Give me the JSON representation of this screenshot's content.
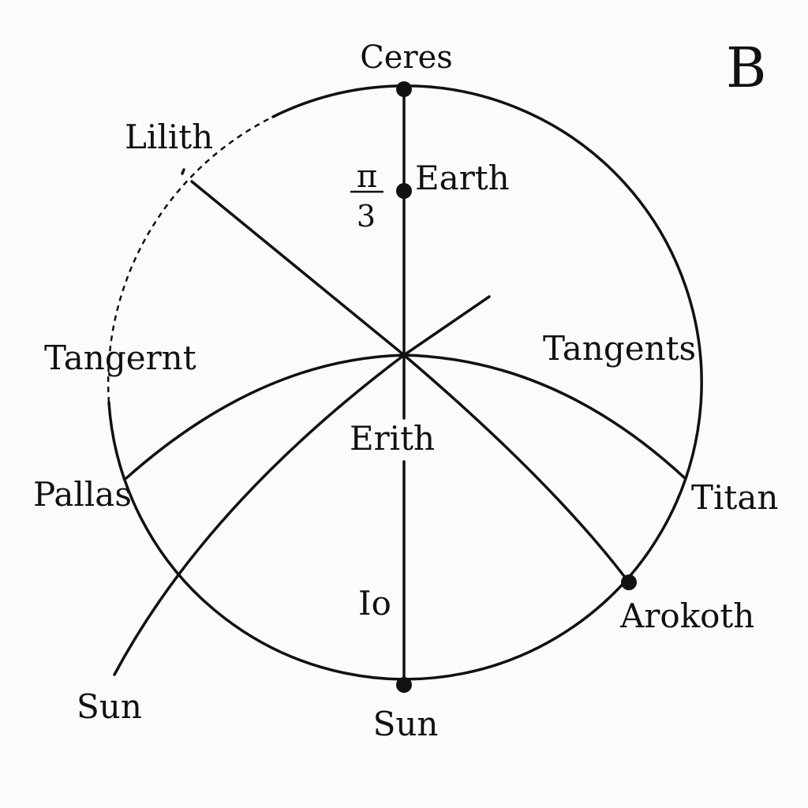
{
  "panel_letter": "B",
  "angle_label": {
    "numerator": "π",
    "denominator": "3"
  },
  "labels": {
    "ceres": "Ceres",
    "earth": "Earth",
    "lilith": "Lilith",
    "tangent_left": "Tangernt",
    "tangents_right": "Tangents",
    "erith": "Erith",
    "pallas": "Pallas",
    "titan": "Titan",
    "io": "Io",
    "arokoth": "Arokoth",
    "sun_bottom": "Sun",
    "sun_left": "Sun"
  },
  "colors": {
    "ink": "#111111",
    "background": "#fbfbfb"
  }
}
